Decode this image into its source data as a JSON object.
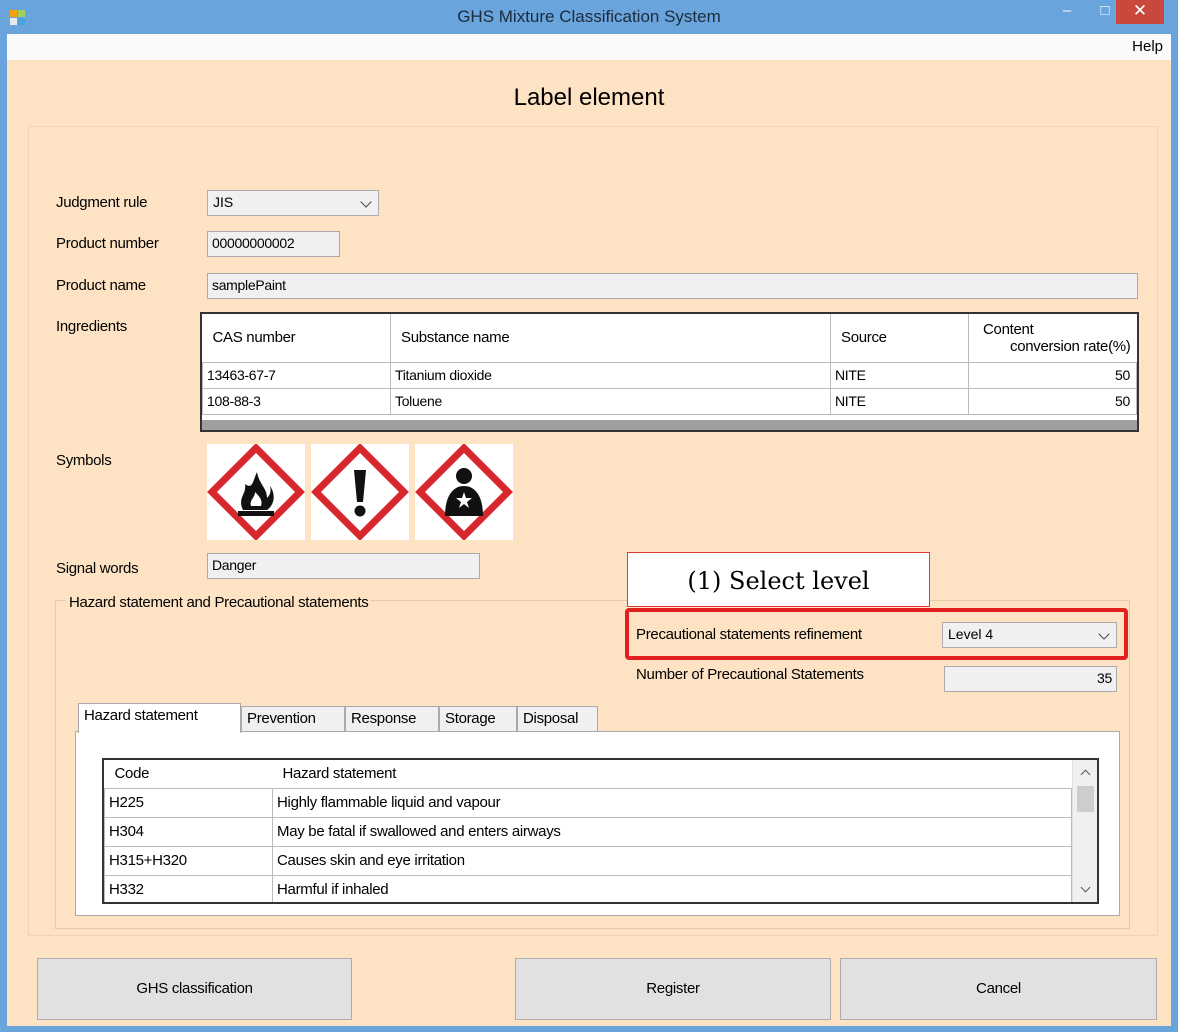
{
  "window": {
    "title": "GHS Mixture Classification System",
    "minimize_glyph": "–",
    "maximize_glyph": "□",
    "close_glyph": "✕"
  },
  "menu": {
    "help": "Help"
  },
  "page": {
    "heading": "Label element"
  },
  "form": {
    "judgment_rule_label": "Judgment rule",
    "judgment_rule_value": "JIS",
    "product_number_label": "Product number",
    "product_number_value": "00000000002",
    "product_name_label": "Product name",
    "product_name_value": "samplePaint",
    "ingredients_label": "Ingredients",
    "symbols_label": "Symbols",
    "signal_words_label": "Signal words",
    "signal_words_value": "Danger"
  },
  "ingredients": {
    "columns": [
      "CAS number",
      "Substance name",
      "Source",
      "Content",
      "conversion rate(%)"
    ],
    "rows": [
      [
        "13463-67-7",
        "Titanium dioxide",
        "NITE",
        "50"
      ],
      [
        "108-88-3",
        "Toluene",
        "NITE",
        "50"
      ]
    ]
  },
  "symbols": [
    "flame-pictogram",
    "exclamation-mark-pictogram",
    "health-hazard-pictogram"
  ],
  "hazard_group": {
    "legend": "Hazard statement and Precautional statements",
    "refinement_label": "Precautional statements refinement",
    "refinement_value": "Level 4",
    "count_label": "Number of Precautional Statements",
    "count_value": "35"
  },
  "callout": {
    "text": "(1) Select level",
    "color": "#e32020"
  },
  "tabs": [
    "Hazard statement",
    "Prevention",
    "Response",
    "Storage",
    "Disposal"
  ],
  "hazard_list": {
    "columns": [
      "Code",
      "Hazard statement"
    ],
    "rows": [
      [
        "H225",
        "Highly flammable liquid and vapour"
      ],
      [
        "H304",
        "May be fatal if swallowed and enters airways"
      ],
      [
        "H315+H320",
        "Causes skin and eye irritation"
      ],
      [
        "H332",
        "Harmful if inhaled"
      ]
    ]
  },
  "buttons": {
    "ghs_classification": "GHS classification",
    "register": "Register",
    "cancel": "Cancel"
  }
}
